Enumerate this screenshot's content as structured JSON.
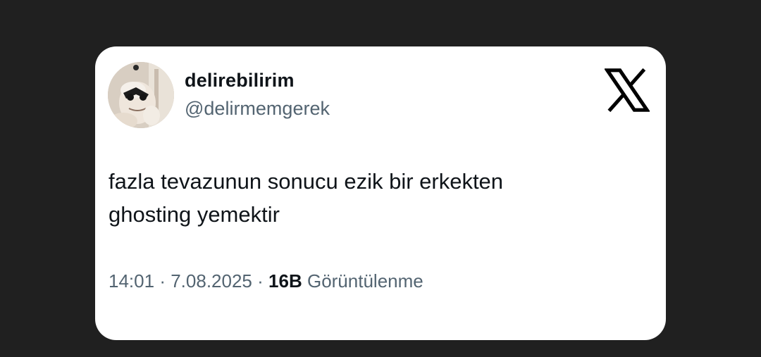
{
  "tweet": {
    "display_name": "delirebilirim",
    "handle": "@delirmemgerek",
    "text_line1": "fazla tevazunun sonucu ezik bir erkekten",
    "text_line2": "ghosting yemektir",
    "time": "14:01",
    "separator": "·",
    "date": "7.08.2025",
    "views_count": "16B",
    "views_label": "Görüntülenme"
  },
  "icons": {
    "brand": "x-logo-icon",
    "avatar": "profile-avatar"
  },
  "colors": {
    "background": "#202020",
    "card": "#ffffff",
    "text_primary": "#0f1419",
    "text_secondary": "#536471"
  }
}
